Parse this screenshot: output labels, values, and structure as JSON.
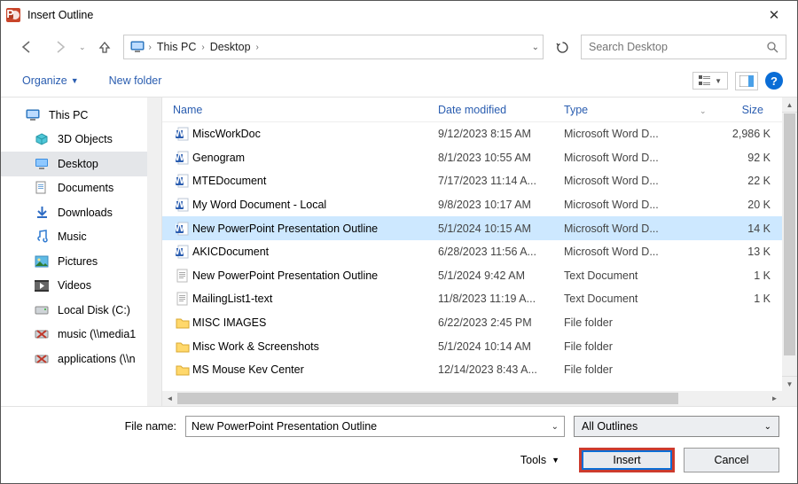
{
  "dialog": {
    "title": "Insert Outline"
  },
  "nav": {
    "crumbs": [
      "This PC",
      "Desktop"
    ],
    "search_placeholder": "Search Desktop"
  },
  "toolbar": {
    "organize": "Organize",
    "new_folder": "New folder"
  },
  "tree": {
    "root": "This PC",
    "children": [
      {
        "label": "3D Objects",
        "icon": "cube"
      },
      {
        "label": "Desktop",
        "icon": "desktop",
        "selected": true
      },
      {
        "label": "Documents",
        "icon": "doc"
      },
      {
        "label": "Downloads",
        "icon": "download"
      },
      {
        "label": "Music",
        "icon": "music"
      },
      {
        "label": "Pictures",
        "icon": "picture"
      },
      {
        "label": "Videos",
        "icon": "video"
      },
      {
        "label": "Local Disk (C:)",
        "icon": "disk"
      },
      {
        "label": "music (\\\\media1",
        "icon": "netx"
      },
      {
        "label": "applications (\\\\n",
        "icon": "netx"
      }
    ]
  },
  "columns": {
    "name": "Name",
    "date": "Date modified",
    "type": "Type",
    "size": "Size"
  },
  "files": [
    {
      "name": "MiscWorkDoc",
      "date": "9/12/2023 8:15 AM",
      "type": "Microsoft Word D...",
      "size": "2,986 K",
      "icon": "word"
    },
    {
      "name": "Genogram",
      "date": "8/1/2023 10:55 AM",
      "type": "Microsoft Word D...",
      "size": "92 K",
      "icon": "word"
    },
    {
      "name": "MTEDocument",
      "date": "7/17/2023 11:14 A...",
      "type": "Microsoft Word D...",
      "size": "22 K",
      "icon": "word"
    },
    {
      "name": "My Word Document - Local",
      "date": "9/8/2023 10:17 AM",
      "type": "Microsoft Word D...",
      "size": "20 K",
      "icon": "word"
    },
    {
      "name": "New PowerPoint Presentation Outline",
      "date": "5/1/2024 10:15 AM",
      "type": "Microsoft Word D...",
      "size": "14 K",
      "icon": "word",
      "selected": true
    },
    {
      "name": "AKICDocument",
      "date": "6/28/2023 11:56 A...",
      "type": "Microsoft Word D...",
      "size": "13 K",
      "icon": "word"
    },
    {
      "name": "New PowerPoint Presentation Outline",
      "date": "5/1/2024 9:42 AM",
      "type": "Text Document",
      "size": "1 K",
      "icon": "text"
    },
    {
      "name": "MailingList1-text",
      "date": "11/8/2023 11:19 A...",
      "type": "Text Document",
      "size": "1 K",
      "icon": "text"
    },
    {
      "name": "MISC IMAGES",
      "date": "6/22/2023 2:45 PM",
      "type": "File folder",
      "size": "",
      "icon": "folder"
    },
    {
      "name": "Misc Work & Screenshots",
      "date": "5/1/2024 10:14 AM",
      "type": "File folder",
      "size": "",
      "icon": "folder"
    },
    {
      "name": "MS Mouse Kev Center",
      "date": "12/14/2023 8:43 A...",
      "type": "File folder",
      "size": "",
      "icon": "folder"
    }
  ],
  "footer": {
    "file_name_label": "File name:",
    "file_name_value": "New PowerPoint Presentation Outline",
    "filter": "All Outlines",
    "tools": "Tools",
    "insert": "Insert",
    "cancel": "Cancel"
  }
}
